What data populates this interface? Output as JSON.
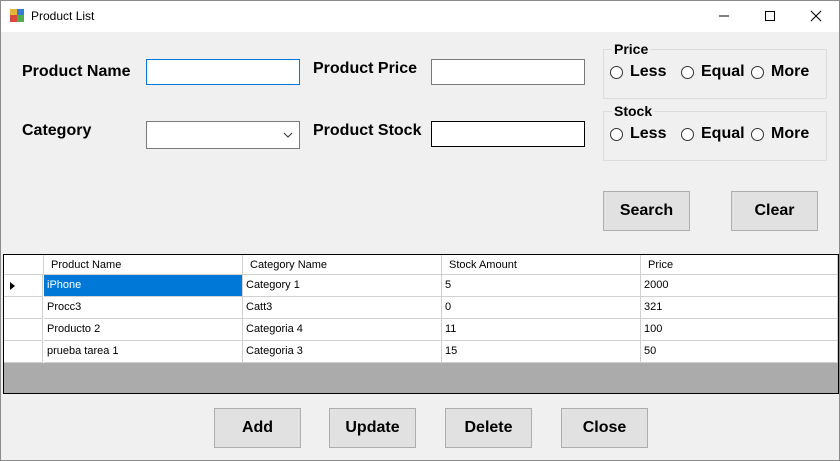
{
  "window": {
    "title": "Product List",
    "controls": {
      "minimize": "minimize",
      "maximize": "maximize",
      "close": "close"
    }
  },
  "form": {
    "product_name_label": "Product Name",
    "product_name_value": "",
    "category_label": "Category",
    "category_value": "",
    "product_price_label": "Product Price",
    "product_price_value": "",
    "product_stock_label": "Product Stock",
    "product_stock_value": ""
  },
  "price_group": {
    "title": "Price",
    "options": [
      "Less",
      "Equal",
      "More"
    ]
  },
  "stock_group": {
    "title": "Stock",
    "options": [
      "Less",
      "Equal",
      "More"
    ]
  },
  "buttons": {
    "search": "Search",
    "clear": "Clear",
    "add": "Add",
    "update": "Update",
    "delete": "Delete",
    "close": "Close"
  },
  "grid": {
    "columns": [
      "Product Name",
      "Category Name",
      "Stock Amount",
      "Price"
    ],
    "rows": [
      [
        "iPhone",
        "Category 1",
        "5",
        "2000"
      ],
      [
        "Procc3",
        "Catt3",
        "0",
        "321"
      ],
      [
        "Producto 2",
        "Categoria 4",
        "11",
        "100"
      ],
      [
        "prueba tarea 1",
        "Categoria 3",
        "15",
        "50"
      ]
    ]
  },
  "icons": {
    "app": "app-icon",
    "combo": "chevron-down-icon",
    "row_pointer": "row-pointer-icon"
  },
  "colors": {
    "selection": "#0078d7",
    "grid_background": "#ababab",
    "window_background": "#f0f0f0"
  }
}
